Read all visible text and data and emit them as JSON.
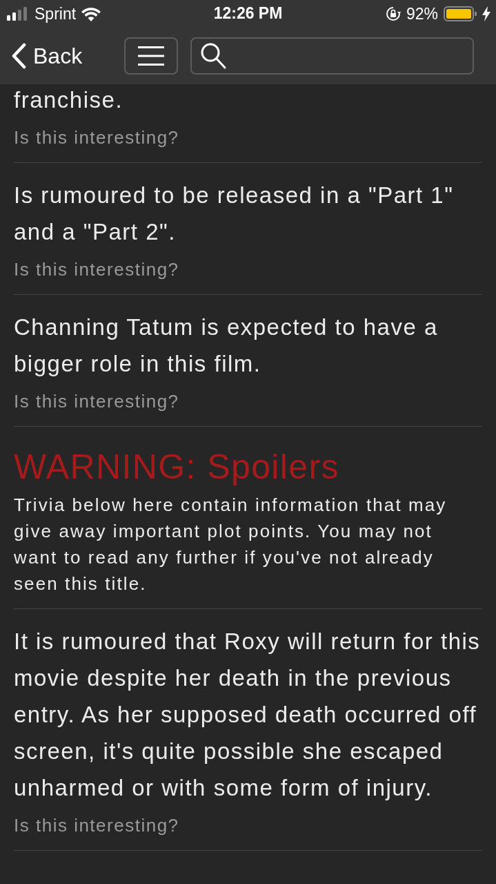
{
  "status_bar": {
    "carrier": "Sprint",
    "time": "12:26 PM",
    "battery": "92%"
  },
  "nav": {
    "back": "Back"
  },
  "trivia": [
    {
      "kind": "item",
      "text": "franchise.",
      "prompt": "Is this interesting?"
    },
    {
      "kind": "item",
      "text": "Is rumoured to be released in a \"Part 1\" and a \"Part 2\".",
      "prompt": "Is this interesting?"
    },
    {
      "kind": "item",
      "text": "Channing Tatum is expected to have a bigger role in this film.",
      "prompt": "Is this interesting?"
    },
    {
      "kind": "warning",
      "title": "WARNING: Spoilers",
      "text": "Trivia below here contain information that may give away important plot points. You may not want to read any further if you've not already seen this title."
    },
    {
      "kind": "item",
      "text": "It is rumoured that Roxy will return for this movie despite her death in the previous entry. As her supposed death occurred off screen, it's quite possible she escaped unharmed or with some form of injury.",
      "prompt": "Is this interesting?"
    }
  ]
}
